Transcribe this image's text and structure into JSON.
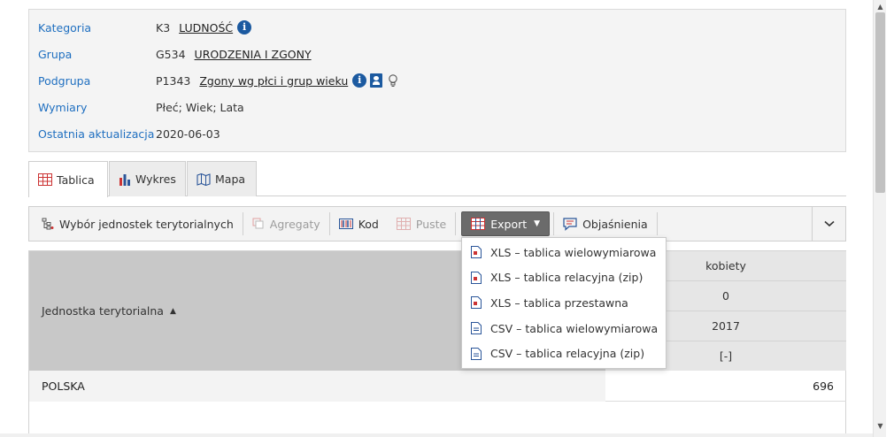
{
  "info": {
    "kategoria": {
      "label": "Kategoria",
      "code": "K3",
      "value": "LUDNOŚĆ"
    },
    "grupa": {
      "label": "Grupa",
      "code": "G534",
      "value": "URODZENIA I ZGONY"
    },
    "podgrupa": {
      "label": "Podgrupa",
      "code": "P1343",
      "value": "Zgony wg płci i grup wieku"
    },
    "wymiary": {
      "label": "Wymiary",
      "value": "Płeć; Wiek; Lata"
    },
    "aktualizacja": {
      "label": "Ostatnia aktualizacja",
      "value": "2020-06-03"
    }
  },
  "tabs": [
    {
      "label": "Tablica",
      "icon": "table-icon",
      "active": true
    },
    {
      "label": "Wykres",
      "icon": "bar-chart-icon",
      "active": false
    },
    {
      "label": "Mapa",
      "icon": "map-icon",
      "active": false
    }
  ],
  "toolbar": {
    "units": "Wybór jednostek terytorialnych",
    "aggregates": "Agregaty",
    "code": "Kod",
    "empty": "Puste",
    "export": "Export",
    "explanations": "Objaśnienia"
  },
  "export_menu": [
    "XLS – tablica wielowymiarowa",
    "XLS – tablica relacyjna (zip)",
    "XLS – tablica przestawna",
    "CSV – tablica wielowymiarowa",
    "CSV – tablica relacyjna (zip)"
  ],
  "table": {
    "header_label": "Jednostka terytorialna",
    "col_headers": [
      "kobiety",
      "0",
      "2017",
      "[-]"
    ],
    "rows": [
      {
        "name": "POLSKA",
        "value": "696"
      }
    ]
  }
}
